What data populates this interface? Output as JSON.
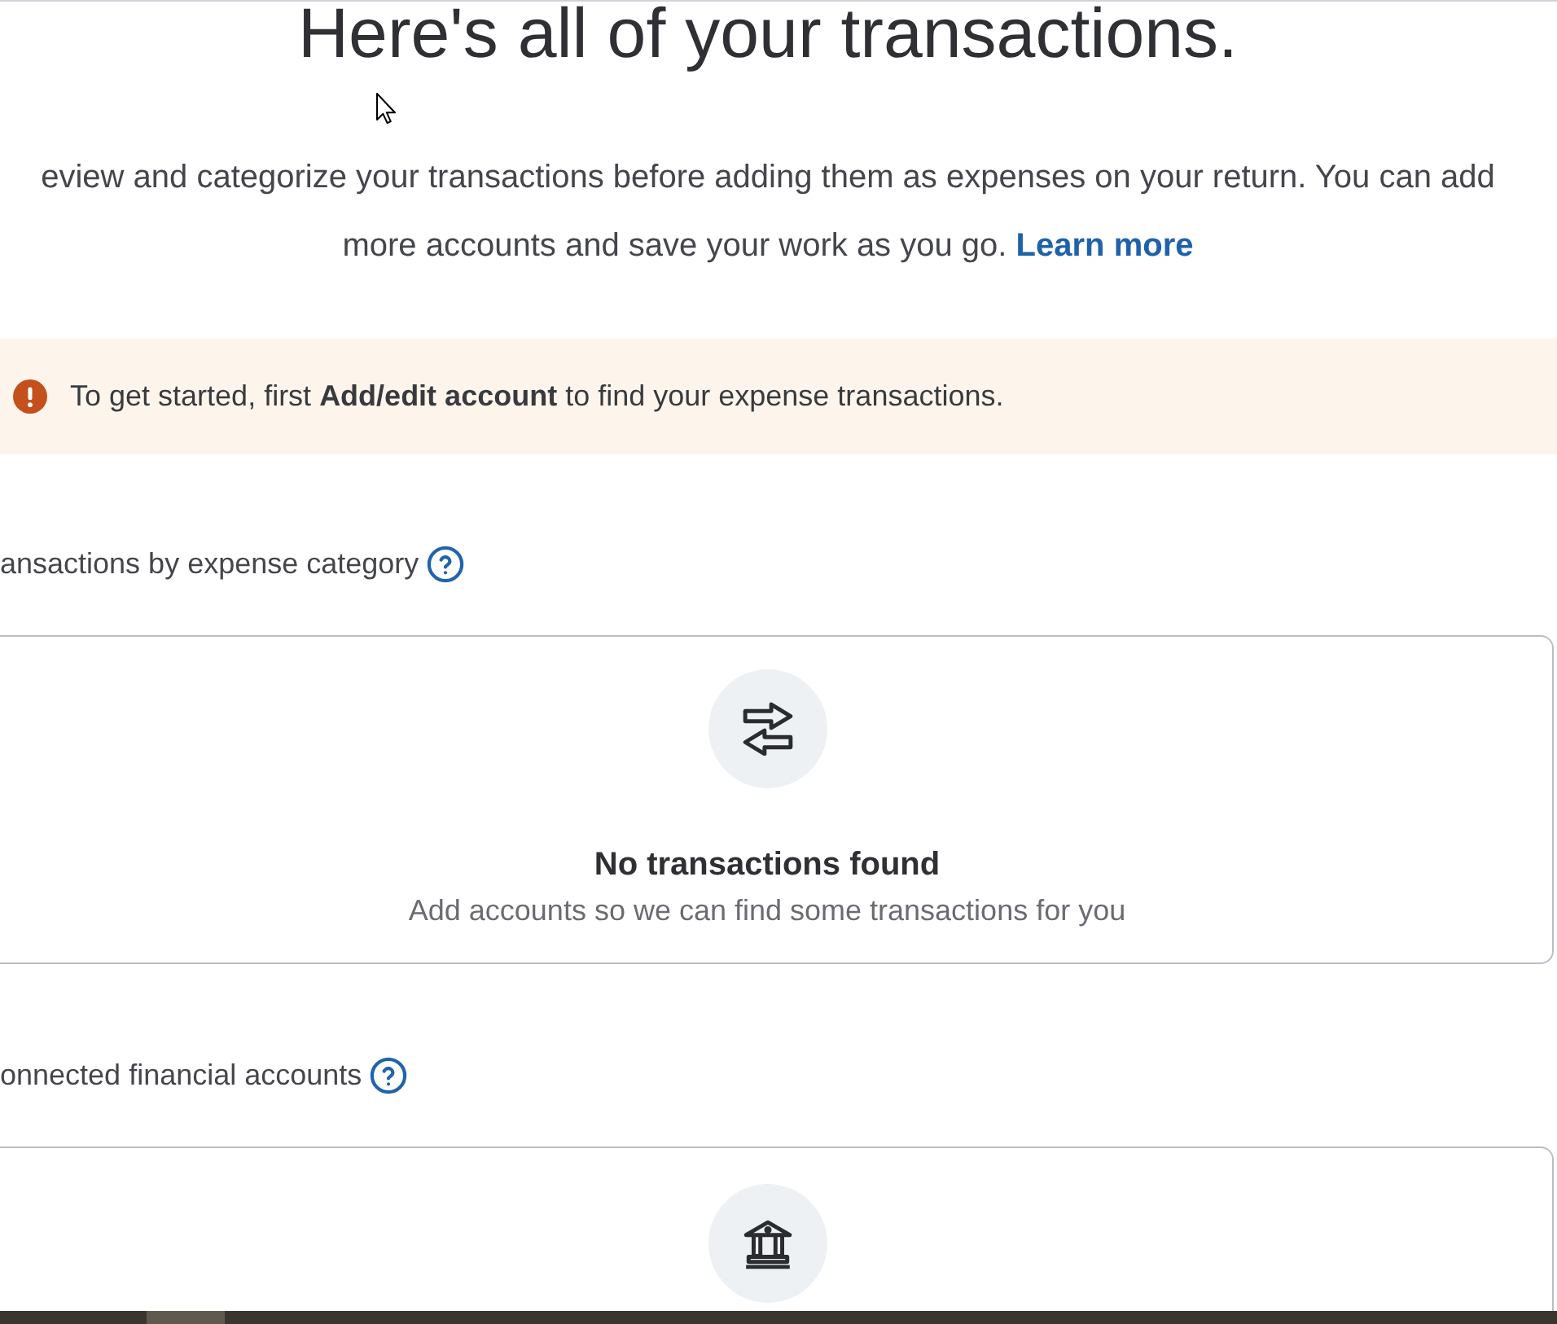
{
  "title": "Here's all of your transactions.",
  "intro": {
    "lines": [
      "eview and categorize your transactions before adding them as expenses on your return. You can add",
      "more accounts and save your work as you go."
    ],
    "link": "Learn more"
  },
  "notice": {
    "kind": "warning",
    "text": "To get started, first **Add/edit account** to find your expense transactions."
  },
  "sections": [
    {
      "kind": "transactions",
      "heading": "ansactions by expense category",
      "empty_title": "No transactions found",
      "empty_text": "Add accounts so we can find some transactions for you"
    },
    {
      "kind": "accounts",
      "heading": "onnected financial accounts"
    }
  ]
}
